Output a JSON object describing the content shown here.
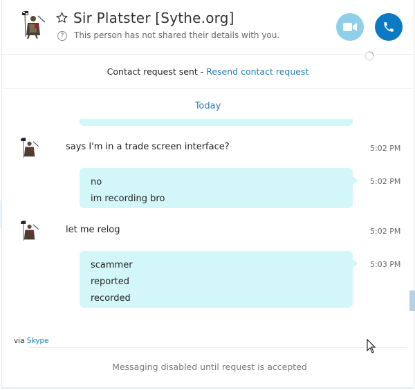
{
  "header": {
    "contact_name": "Sir Platster [Sythe.org]",
    "privacy_notice": "This person has not shared their details with you.",
    "avatar": "knight-avatar",
    "video_call_color": "#8ed0ea",
    "audio_call_color": "#0b79c4"
  },
  "request_bar": {
    "status": "Contact request sent - ",
    "link": "Resend contact request"
  },
  "day_label": "Today",
  "messages": [
    {
      "kind": "incoming",
      "lines": [
        "says I'm in a trade screen interface?"
      ],
      "time": "5:02 PM"
    },
    {
      "kind": "outgoing",
      "lines": [
        "no",
        "im recording bro"
      ],
      "time": "5:02 PM"
    },
    {
      "kind": "incoming",
      "lines": [
        "let me relog"
      ],
      "time": "5:02 PM"
    },
    {
      "kind": "outgoing",
      "lines": [
        "scammer",
        "reported",
        "recorded"
      ],
      "time": "5:03 PM"
    }
  ],
  "via": {
    "prefix": "via ",
    "link": "Skype"
  },
  "footer": {
    "notice": "Messaging disabled until request is accepted"
  },
  "colors": {
    "accent": "#1a7fbf",
    "bubble": "#d3f7f9"
  }
}
